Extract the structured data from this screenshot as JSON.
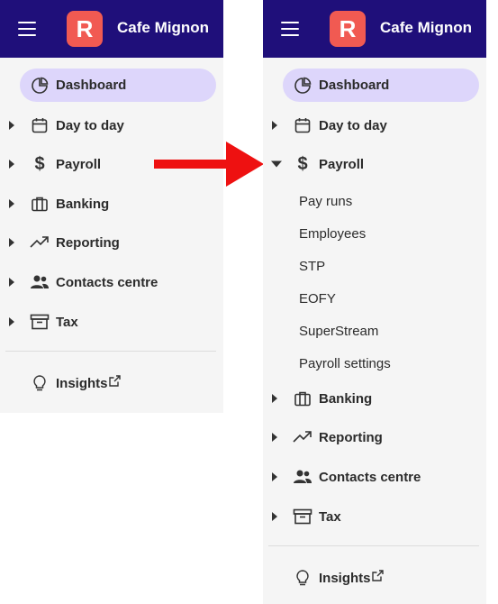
{
  "header": {
    "logo_letter": "R",
    "app_name": "Cafe Mignon"
  },
  "nav": {
    "dashboard": "Dashboard",
    "day_to_day": "Day to day",
    "payroll": "Payroll",
    "banking": "Banking",
    "reporting": "Reporting",
    "contacts_centre": "Contacts centre",
    "tax": "Tax",
    "insights": "Insights"
  },
  "payroll_submenu": [
    "Pay runs",
    "Employees",
    "STP",
    "EOFY",
    "SuperStream",
    "Payroll settings"
  ],
  "colors": {
    "header_bg": "#1f0f7a",
    "logo_bg": "#f15a52",
    "active_pill": "#ddd6fb",
    "sidebar_bg": "#f5f5f5",
    "arrow": "#ee1111"
  },
  "icons": [
    "menu-icon",
    "pie-chart-icon",
    "calendar-icon",
    "dollar-icon",
    "briefcase-icon",
    "trending-up-icon",
    "users-icon",
    "archive-icon",
    "lightbulb-icon",
    "external-link-icon",
    "right-arrow-icon"
  ]
}
